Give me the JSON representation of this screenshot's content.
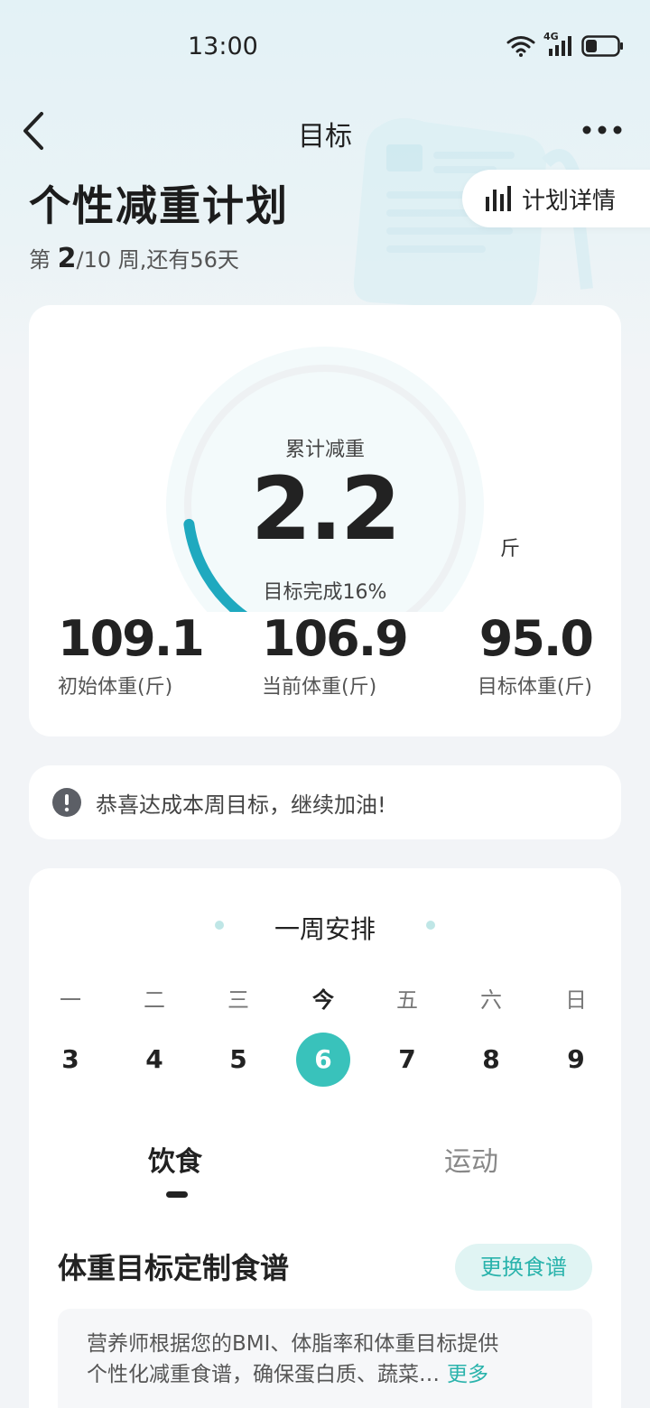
{
  "status_bar": {
    "time": "13:00",
    "network_label": "4G"
  },
  "nav": {
    "title": "目标",
    "back_icon": "chevron-left-icon",
    "more_icon": "more-horizontal-icon"
  },
  "plan": {
    "title": "个性减重计划",
    "week_prefix": "第 ",
    "week_current": "2",
    "week_suffix": "/10 周,还有56天",
    "detail_button_label": "计划详情",
    "detail_icon": "bar-chart-icon"
  },
  "progress": {
    "label": "累计减重",
    "value": "2.2",
    "unit": "斤",
    "completion_text": "目标完成16%",
    "completion_fraction": 0.16,
    "accent_color": "#1fa9bf"
  },
  "stats": [
    {
      "value": "109.1",
      "caption": "初始体重(斤)"
    },
    {
      "value": "106.9",
      "caption": "当前体重(斤)"
    },
    {
      "value": "95.0",
      "caption": "目标体重(斤)"
    }
  ],
  "notice": {
    "icon": "exclamation-circle-icon",
    "text": "恭喜达成本周目标，继续加油!"
  },
  "week": {
    "title": "一周安排",
    "days": [
      {
        "name": "一",
        "num": "3",
        "today": false
      },
      {
        "name": "二",
        "num": "4",
        "today": false
      },
      {
        "name": "三",
        "num": "5",
        "today": false
      },
      {
        "name": "今",
        "num": "6",
        "today": true
      },
      {
        "name": "五",
        "num": "7",
        "today": false
      },
      {
        "name": "六",
        "num": "8",
        "today": false
      },
      {
        "name": "日",
        "num": "9",
        "today": false
      }
    ],
    "tabs": {
      "diet": "饮食",
      "exercise": "运动"
    }
  },
  "recipe": {
    "title": "体重目标定制食谱",
    "change_button": "更换食谱",
    "description_line1": "营养师根据您的BMI、体脂率和体重目标提供",
    "description_line2": "个性化减重食谱，确保蛋白质、蔬菜…",
    "more_link": "更多"
  },
  "colors": {
    "brand": "#39c2bb",
    "accent_text": "#2ab3ac"
  }
}
